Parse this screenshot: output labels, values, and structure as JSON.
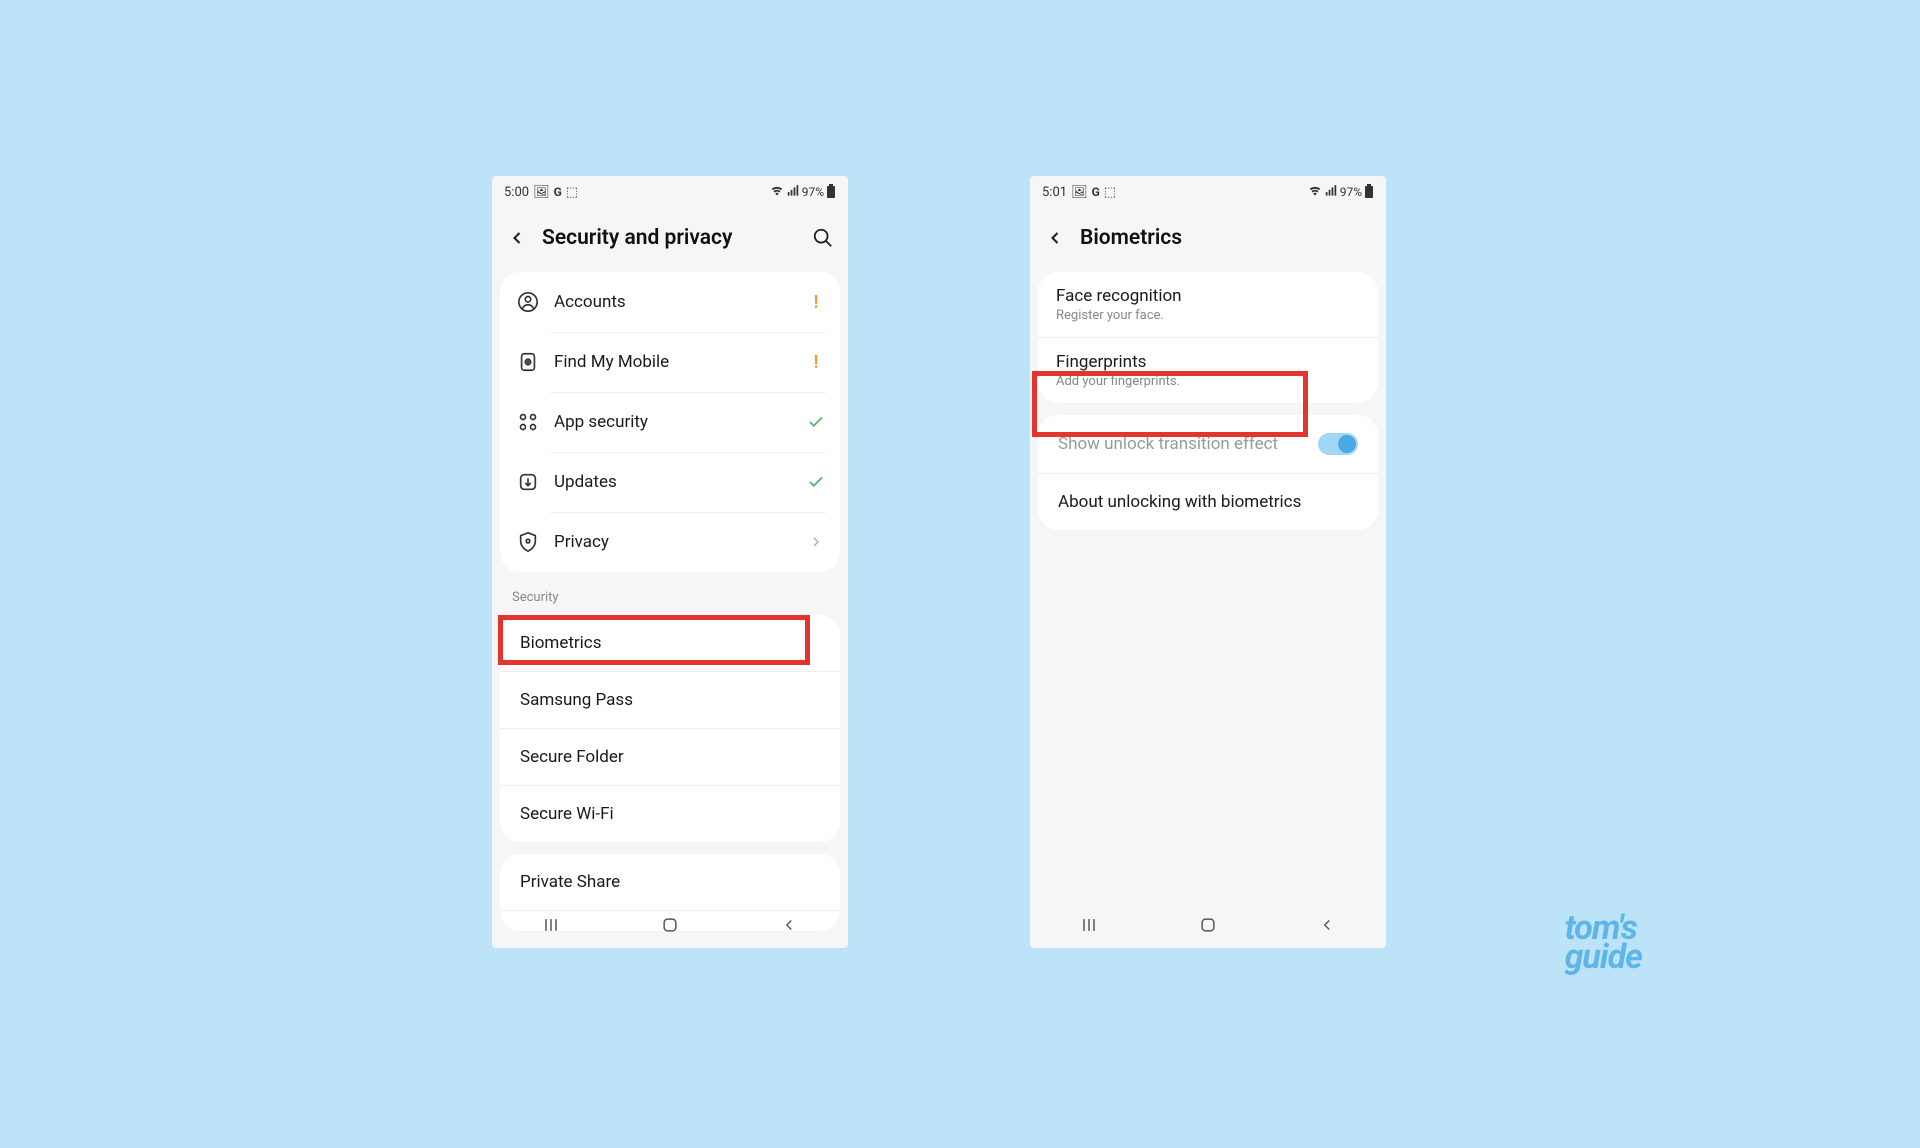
{
  "left": {
    "status": {
      "time": "5:00",
      "battery": "97%"
    },
    "header": {
      "title": "Security and privacy"
    },
    "top_items": [
      {
        "label": "Accounts",
        "status": "warn"
      },
      {
        "label": "Find My Mobile",
        "status": "warn"
      },
      {
        "label": "App security",
        "status": "check"
      },
      {
        "label": "Updates",
        "status": "check"
      },
      {
        "label": "Privacy",
        "status": "chev"
      }
    ],
    "section_label": "Security",
    "security_items": [
      "Biometrics",
      "Samsung Pass",
      "Secure Folder",
      "Secure Wi-Fi"
    ],
    "bottom_items": [
      "Private Share"
    ]
  },
  "right": {
    "status": {
      "time": "5:01",
      "battery": "97%"
    },
    "header": {
      "title": "Biometrics"
    },
    "bio_items": [
      {
        "title": "Face recognition",
        "sub": "Register your face."
      },
      {
        "title": "Fingerprints",
        "sub": "Add your fingerprints."
      }
    ],
    "transition_label": "Show unlock transition effect",
    "about_label": "About unlocking with biometrics"
  },
  "watermark": {
    "line1": "tom's",
    "line2": "guide"
  }
}
